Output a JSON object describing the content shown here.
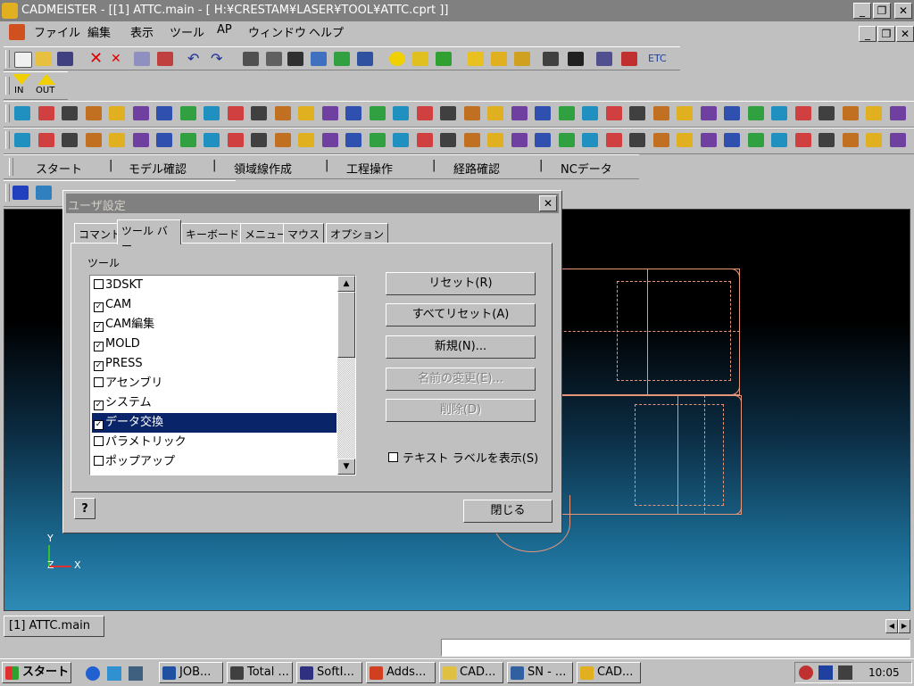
{
  "window": {
    "title": "CADMEISTER - [[1] ATTC.main - [ H:¥CRESTAM¥LASER¥TOOL¥ATTC.cprt ]]",
    "minimize": "_",
    "restore": "❐",
    "close": "✕"
  },
  "menu": [
    "ファイル",
    "編集",
    "表示",
    "ツール",
    "AP",
    "ウィンドウ",
    "ヘルプ"
  ],
  "toolbar": {
    "etc_label": "ETC",
    "in_label": "IN",
    "out_label": "OUT",
    "process_bar": [
      "スタート",
      "モデル確認",
      "領域線作成",
      "工程操作",
      "経路確認",
      "NCデータ"
    ]
  },
  "dialog": {
    "title": "ユーザ設定",
    "close": "✕",
    "tabs": [
      "コマンド",
      "ツール バー",
      "キーボード",
      "メニュー",
      "マウス",
      "オプション"
    ],
    "active_tab": "ツール バー",
    "group_label": "ツール",
    "tools": [
      {
        "label": "3DSKT",
        "checked": false,
        "selected": false
      },
      {
        "label": "CAM",
        "checked": true,
        "selected": false
      },
      {
        "label": "CAM編集",
        "checked": true,
        "selected": false
      },
      {
        "label": "MOLD",
        "checked": true,
        "selected": false
      },
      {
        "label": "PRESS",
        "checked": true,
        "selected": false
      },
      {
        "label": "アセンブリ",
        "checked": false,
        "selected": false
      },
      {
        "label": "システム",
        "checked": true,
        "selected": false
      },
      {
        "label": "データ交換",
        "checked": true,
        "selected": true
      },
      {
        "label": "パラメトリック",
        "checked": false,
        "selected": false
      },
      {
        "label": "ポップアップ",
        "checked": false,
        "selected": false
      }
    ],
    "buttons": {
      "reset": "リセット(R)",
      "reset_all": "すべてリセット(A)",
      "new": "新規(N)...",
      "rename": "名前の変更(E)...",
      "delete": "削除(D)"
    },
    "show_text_label": "テキスト ラベルを表示(S)",
    "show_text_checked": false,
    "help": "?",
    "close_button": "閉じる"
  },
  "viewport": {
    "axis_y": "Y",
    "axis_z": "Z",
    "axis_x": "X"
  },
  "document_tab": "[1] ATTC.main",
  "taskbar": {
    "start": "スタート",
    "items": [
      "JOB...",
      "Total ...",
      "SoftI...",
      "Adds...",
      "CAD...",
      "SN - ...",
      "CAD..."
    ],
    "clock": "10:05"
  },
  "colors": {
    "selection": "#0a246a",
    "wireframe": "#e8967a",
    "title_inactive": "#808080"
  }
}
